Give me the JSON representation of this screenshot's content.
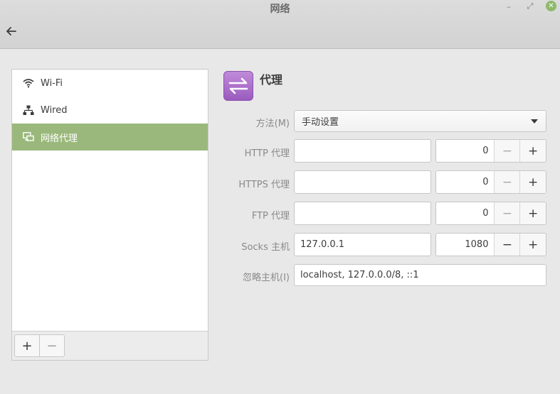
{
  "window": {
    "title": "网络",
    "min_glyph": "–",
    "max_glyph": "⤢",
    "close_glyph": "✕"
  },
  "sidebar": {
    "items": [
      {
        "label": "Wi-Fi",
        "icon": "wifi-icon"
      },
      {
        "label": "Wired",
        "icon": "network-wired-icon"
      },
      {
        "label": "网络代理",
        "icon": "network-proxy-icon",
        "selected": true
      }
    ],
    "add_label": "+",
    "remove_label": "−"
  },
  "proxy": {
    "title": "代理",
    "method_label": "方法(M)",
    "method_value": "手动设置",
    "http_label": "HTTP 代理",
    "http_host": "",
    "http_port": "0",
    "https_label": "HTTPS 代理",
    "https_host": "",
    "https_port": "0",
    "ftp_label": "FTP 代理",
    "ftp_host": "",
    "ftp_port": "0",
    "socks_label": "Socks 主机",
    "socks_host": "127.0.0.1",
    "socks_port": "1080",
    "ignore_label": "忽略主机(I)",
    "ignore_value": "localhost, 127.0.0.0/8, ::1",
    "minus_glyph": "−",
    "plus_glyph": "+"
  },
  "colors": {
    "selected_bg": "#9ab87b",
    "close_button": "#8fb96b",
    "proxy_icon": "#b27ad0"
  }
}
